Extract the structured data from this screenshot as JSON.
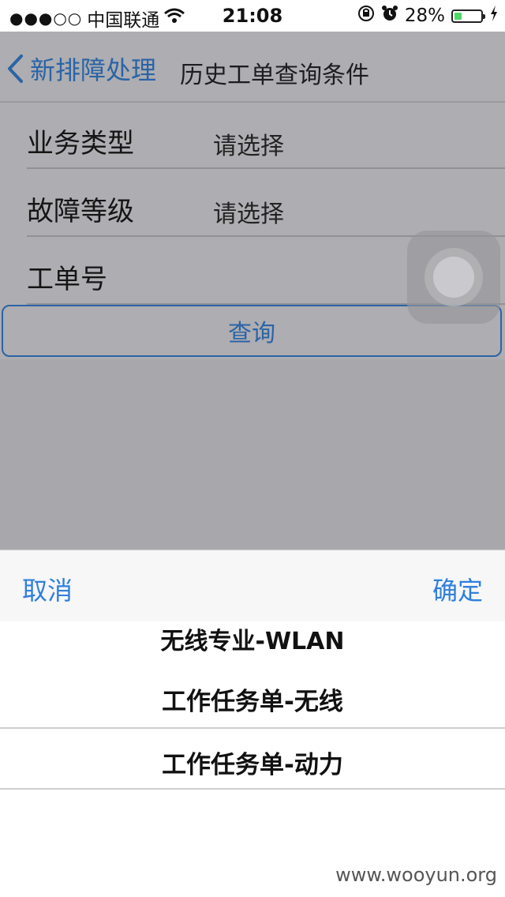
{
  "status_bar": {
    "carrier": "中国联通",
    "time": "21:08",
    "battery_percent": "28%",
    "battery_level": 0.28,
    "icons": [
      "signal-dots-icon",
      "wifi-icon",
      "rotation-lock-icon",
      "alarm-icon",
      "battery-icon",
      "charging-icon"
    ]
  },
  "nav": {
    "back_label": "新排障处理",
    "title": "历史工单查询条件"
  },
  "form": {
    "rows": [
      {
        "label": "业务类型",
        "value": "请选择"
      },
      {
        "label": "故障等级",
        "value": "请选择"
      },
      {
        "label": "工单号",
        "value": ""
      }
    ],
    "query_button": "查询"
  },
  "picker": {
    "cancel": "取消",
    "confirm": "确定",
    "options": [
      "无线专业-WLAN",
      "工作任务单-无线",
      "工作任务单-动力"
    ],
    "selected_index": 2
  },
  "watermark": "www.wooyun.org",
  "colors": {
    "accent": "#2f7fdc",
    "dim_accent": "#2a64a6",
    "overlay": "#a8a7ab",
    "battery_fill": "#4cd964"
  }
}
